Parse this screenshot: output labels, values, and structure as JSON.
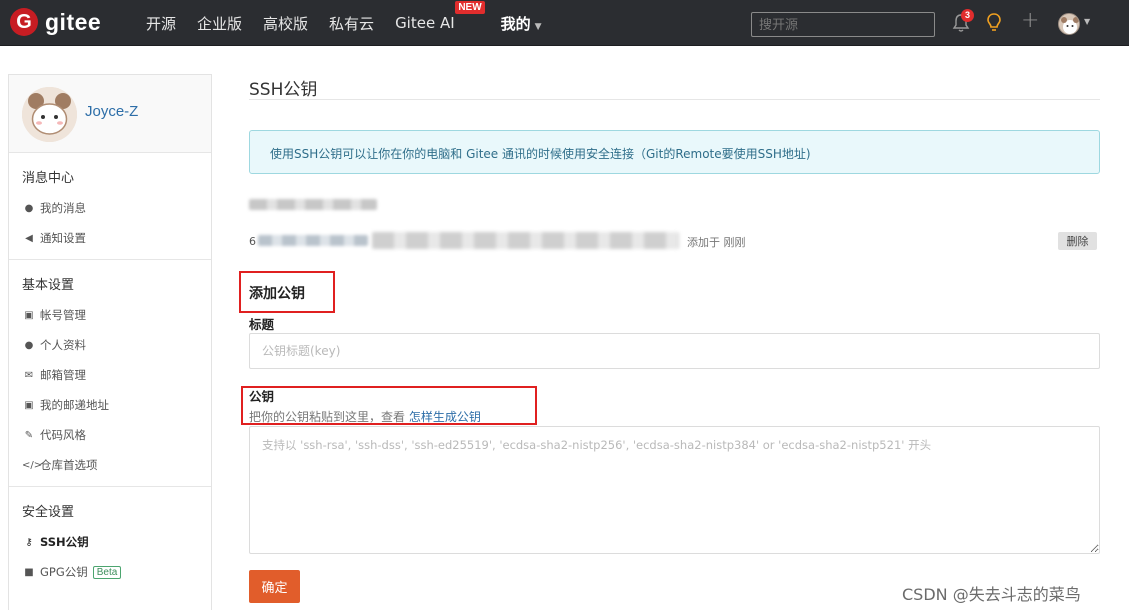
{
  "topbar": {
    "logo_mark": "G",
    "logo_text": "gitee",
    "nav": [
      "开源",
      "企业版",
      "高校版",
      "私有云",
      "Gitee AI"
    ],
    "new_badge": "NEW",
    "mine": "我的",
    "search_placeholder": "搜开源",
    "notification_count": "3"
  },
  "sidebar": {
    "username": "Joyce-Z",
    "sections": [
      {
        "title": "消息中心",
        "items": [
          {
            "icon": "bell-icon",
            "glyph": "🔔",
            "label": "我的消息"
          },
          {
            "icon": "speaker-icon",
            "glyph": "◀)",
            "label": "通知设置"
          }
        ]
      },
      {
        "title": "基本设置",
        "items": [
          {
            "icon": "id-card-icon",
            "glyph": "▣",
            "label": "帐号管理"
          },
          {
            "icon": "person-icon",
            "glyph": "●",
            "label": "个人资料"
          },
          {
            "icon": "envelope-icon",
            "glyph": "✉",
            "label": "邮箱管理"
          },
          {
            "icon": "address-card-icon",
            "glyph": "▣",
            "label": "我的邮递地址"
          },
          {
            "icon": "brush-icon",
            "glyph": "✎",
            "label": "代码风格"
          },
          {
            "icon": "code-icon",
            "glyph": "</>",
            "label": "仓库首选项"
          }
        ]
      },
      {
        "title": "安全设置",
        "items": [
          {
            "icon": "key-icon",
            "glyph": "🔑",
            "label": "SSH公钥",
            "active": true
          },
          {
            "icon": "lock-icon",
            "glyph": "🔒",
            "label": "GPG公钥",
            "badge": "Beta"
          }
        ]
      }
    ]
  },
  "main": {
    "title": "SSH公钥",
    "info": "使用SSH公钥可以让你在你的电脑和 Gitee 通讯的时候使用安全连接（Git的Remote要使用SSH地址)",
    "key_prefix": "6",
    "added_text": "添加于 刚刚",
    "delete_label": "删除",
    "add_heading": "添加公钥",
    "title_label": "标题",
    "title_placeholder": "公钥标题(key)",
    "key_label": "公钥",
    "hint_text": "把你的公钥粘贴到这里，查看 ",
    "hint_link": "怎样生成公钥",
    "key_placeholder": "支持以 'ssh-rsa', 'ssh-dss', 'ssh-ed25519', 'ecdsa-sha2-nistp256', 'ecdsa-sha2-nistp384' or 'ecdsa-sha2-nistp521' 开头",
    "submit_label": "确定"
  },
  "watermark": "CSDN @失去斗志的菜鸟",
  "colors": {
    "brand": "#c71d23",
    "submit": "#e15d2b",
    "highlight": "#e02020",
    "link": "#2d6ea8"
  }
}
